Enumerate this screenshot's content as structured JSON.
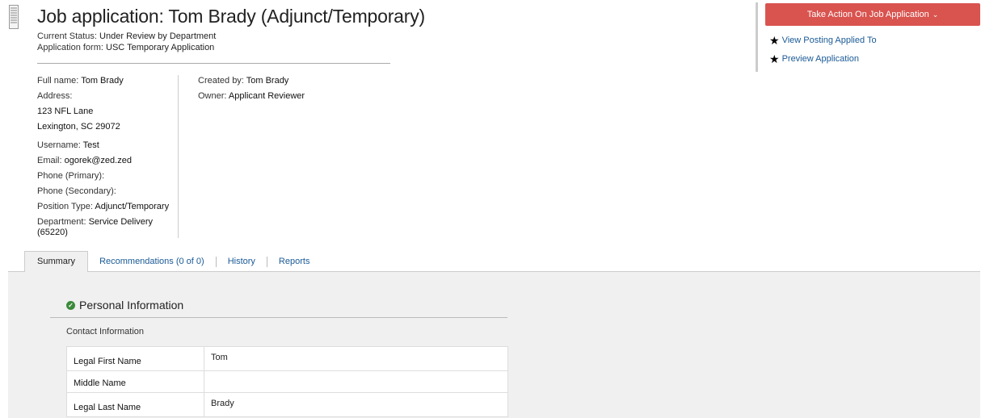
{
  "header": {
    "title": "Job application: Tom Brady (Adjunct/Temporary)",
    "status_label": "Current Status:",
    "status_value": "Under Review by Department",
    "form_label": "Application form:",
    "form_value": "USC Temporary Application",
    "icon": "document-icon"
  },
  "details": {
    "full_name_label": "Full name:",
    "full_name": "Tom Brady",
    "address_label": "Address:",
    "address_line1": "123 NFL Lane",
    "address_line2": "Lexington, SC 29072",
    "username_label": "Username:",
    "username": "Test",
    "email_label": "Email:",
    "email": "ogorek@zed.zed",
    "phone_primary_label": "Phone (Primary):",
    "phone_secondary_label": "Phone (Secondary):",
    "position_type_label": "Position Type:",
    "position_type": "Adjunct/Temporary",
    "department_label": "Department:",
    "department": "Service Delivery (65220)",
    "created_by_label": "Created by:",
    "created_by": "Tom Brady",
    "owner_label": "Owner:",
    "owner": "Applicant Reviewer"
  },
  "actions": {
    "take_action_label": "Take Action On Job Application",
    "button_color": "#d9534f",
    "links": [
      {
        "label": "View Posting Applied To",
        "icon": "star-icon"
      },
      {
        "label": "Preview Application",
        "icon": "star-icon"
      }
    ]
  },
  "tabs": [
    {
      "label": "Summary",
      "active": true
    },
    {
      "label": "Recommendations (0 of 0)",
      "active": false
    },
    {
      "label": "History",
      "active": false
    },
    {
      "label": "Reports",
      "active": false
    }
  ],
  "section": {
    "title": "Personal Information",
    "icon": "check-circle-icon",
    "subheading": "Contact Information",
    "rows": [
      {
        "label": "Legal First Name",
        "value": "Tom"
      },
      {
        "label": "Middle Name",
        "value": ""
      },
      {
        "label": "Legal Last Name",
        "value": "Brady"
      }
    ]
  }
}
